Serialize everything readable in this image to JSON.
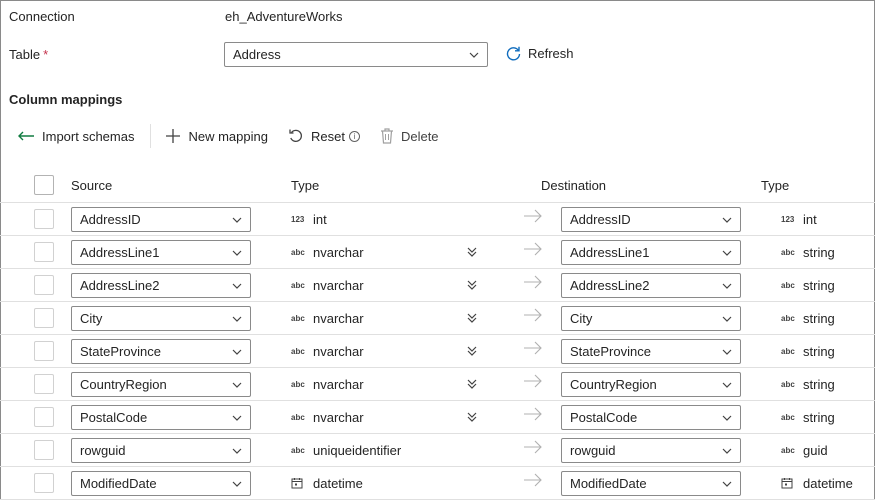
{
  "connection": {
    "label": "Connection",
    "value": "eh_AdventureWorks"
  },
  "table": {
    "label": "Table",
    "required_mark": "*",
    "selected": "Address",
    "refresh_label": "Refresh"
  },
  "mappings": {
    "title": "Column mappings",
    "toolbar": {
      "import_label": "Import schemas",
      "new_label": "New mapping",
      "reset_label": "Reset",
      "delete_label": "Delete"
    },
    "headers": {
      "source": "Source",
      "type": "Type",
      "destination": "Destination",
      "dest_type": "Type"
    },
    "rows": [
      {
        "source": "AddressID",
        "src_type_icon": "123",
        "src_type": "int",
        "dest": "AddressID",
        "dst_type_icon": "123",
        "dst_type": "int",
        "convertible": false
      },
      {
        "source": "AddressLine1",
        "src_type_icon": "abc",
        "src_type": "nvarchar",
        "dest": "AddressLine1",
        "dst_type_icon": "abc",
        "dst_type": "string",
        "convertible": true
      },
      {
        "source": "AddressLine2",
        "src_type_icon": "abc",
        "src_type": "nvarchar",
        "dest": "AddressLine2",
        "dst_type_icon": "abc",
        "dst_type": "string",
        "convertible": true
      },
      {
        "source": "City",
        "src_type_icon": "abc",
        "src_type": "nvarchar",
        "dest": "City",
        "dst_type_icon": "abc",
        "dst_type": "string",
        "convertible": true
      },
      {
        "source": "StateProvince",
        "src_type_icon": "abc",
        "src_type": "nvarchar",
        "dest": "StateProvince",
        "dst_type_icon": "abc",
        "dst_type": "string",
        "convertible": true
      },
      {
        "source": "CountryRegion",
        "src_type_icon": "abc",
        "src_type": "nvarchar",
        "dest": "CountryRegion",
        "dst_type_icon": "abc",
        "dst_type": "string",
        "convertible": true
      },
      {
        "source": "PostalCode",
        "src_type_icon": "abc",
        "src_type": "nvarchar",
        "dest": "PostalCode",
        "dst_type_icon": "abc",
        "dst_type": "string",
        "convertible": true
      },
      {
        "source": "rowguid",
        "src_type_icon": "abc",
        "src_type": "uniqueidentifier",
        "dest": "rowguid",
        "dst_type_icon": "abc",
        "dst_type": "guid",
        "convertible": false
      },
      {
        "source": "ModifiedDate",
        "src_type_icon": "calendar",
        "src_type": "datetime",
        "dest": "ModifiedDate",
        "dst_type_icon": "calendar",
        "dst_type": "datetime",
        "convertible": false
      }
    ]
  },
  "colors": {
    "accent": "#0f6cbd",
    "border": "#8a8a8a",
    "divider": "#e0e0e0",
    "text": "#242424",
    "required": "#c4314b"
  }
}
